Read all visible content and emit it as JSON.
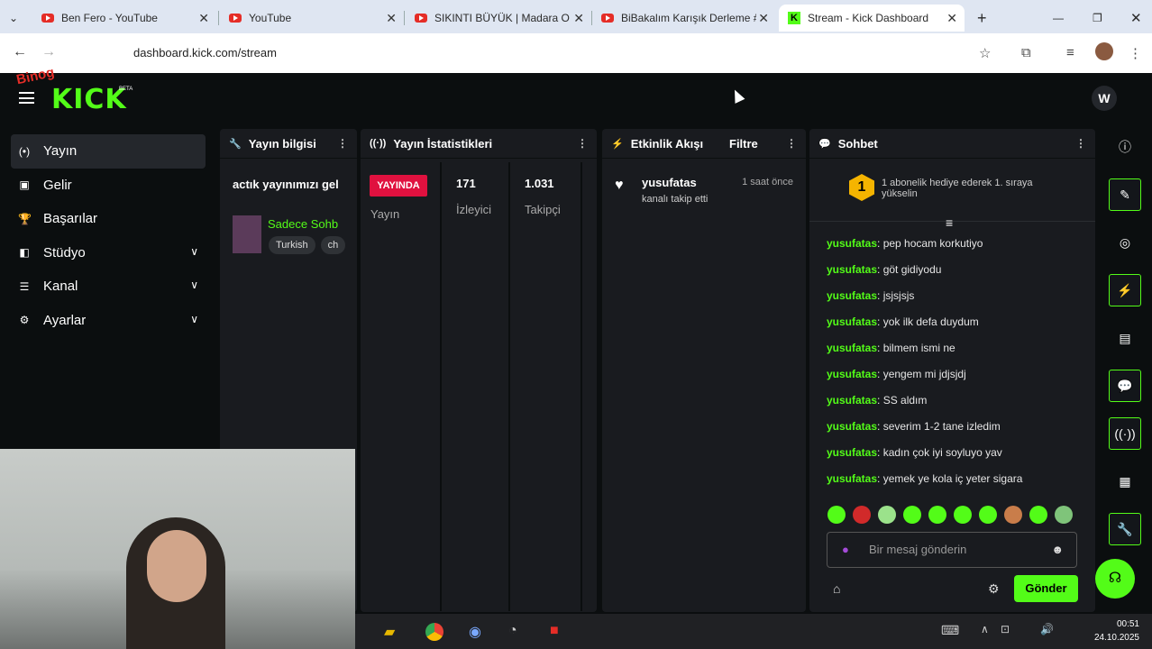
{
  "browser": {
    "tabs": [
      {
        "title": "Ben Fero - YouTube",
        "icon": "youtube-icon"
      },
      {
        "title": "YouTube",
        "icon": "youtube-icon"
      },
      {
        "title": "SIKINTI BÜYÜK | Madara Old",
        "icon": "youtube-icon"
      },
      {
        "title": "BiBakalım Karışık Derleme #",
        "icon": "youtube-icon"
      },
      {
        "title": "Stream - Kick Dashboard",
        "icon": "kick-icon"
      }
    ],
    "url": "dashboard.kick.com/stream"
  },
  "overlay": {
    "text": "Binog"
  },
  "app": {
    "logo": "KICK",
    "beta": "BETA",
    "avatar": "W",
    "sidebar": [
      {
        "label": "Yayın",
        "icon": "broadcast-icon",
        "selected": true
      },
      {
        "label": "Gelir",
        "icon": "revenue-icon"
      },
      {
        "label": "Başarılar",
        "icon": "trophy-icon"
      },
      {
        "label": "Stüdyo",
        "icon": "studio-icon",
        "expandable": true
      },
      {
        "label": "Kanal",
        "icon": "channel-icon",
        "expandable": true
      },
      {
        "label": "Ayarlar",
        "icon": "gear-icon",
        "expandable": true
      }
    ],
    "stream_info": {
      "header": "Yayın bilgisi",
      "title": "actık yayınımızı gel",
      "category": "Sadece Sohb",
      "tags": [
        "Turkish",
        "ch"
      ]
    },
    "stats": {
      "header": "Yayın İstatistikleri",
      "live_badge": "YAYINDA",
      "status_label": "Yayın",
      "viewers": "171",
      "viewers_label": "İzleyici",
      "followers": "1.031",
      "followers_label": "Takipçi"
    },
    "activity": {
      "header": "Etkinlik Akışı",
      "filter": "Filtre",
      "items": [
        {
          "user": "yusufatas",
          "text": "kanalı takip etti",
          "time": "1 saat önce"
        }
      ]
    },
    "chat": {
      "header": "Sohbet",
      "pinned": "1 abonelik hediye ederek 1. sıraya yükselin",
      "pinned_rank": "1",
      "messages": [
        {
          "user": "yusufatas",
          "text": ": pep hocam korkutiyo"
        },
        {
          "user": "yusufatas",
          "text": ": göt gidiyodu"
        },
        {
          "user": "yusufatas",
          "text": ": jsjsjsjs"
        },
        {
          "user": "yusufatas",
          "text": ": yok ilk defa duydum"
        },
        {
          "user": "yusufatas",
          "text": ": bilmem ismi ne"
        },
        {
          "user": "yusufatas",
          "text": ": yengem mi jdjsjdj"
        },
        {
          "user": "yusufatas",
          "text": ": SS aldım"
        },
        {
          "user": "yusufatas",
          "text": ": severim 1-2 tane izledim"
        },
        {
          "user": "yusufatas",
          "text": ": kadın çok iyi soyluyo yav"
        },
        {
          "user": "yusufatas",
          "text": ": yemek ye kola iç yeter sigara"
        }
      ],
      "input_placeholder": "Bir mesaj gönderin",
      "send": "Gönder"
    }
  },
  "taskbar": {
    "time": "00:51",
    "date": "24.10.2025"
  }
}
